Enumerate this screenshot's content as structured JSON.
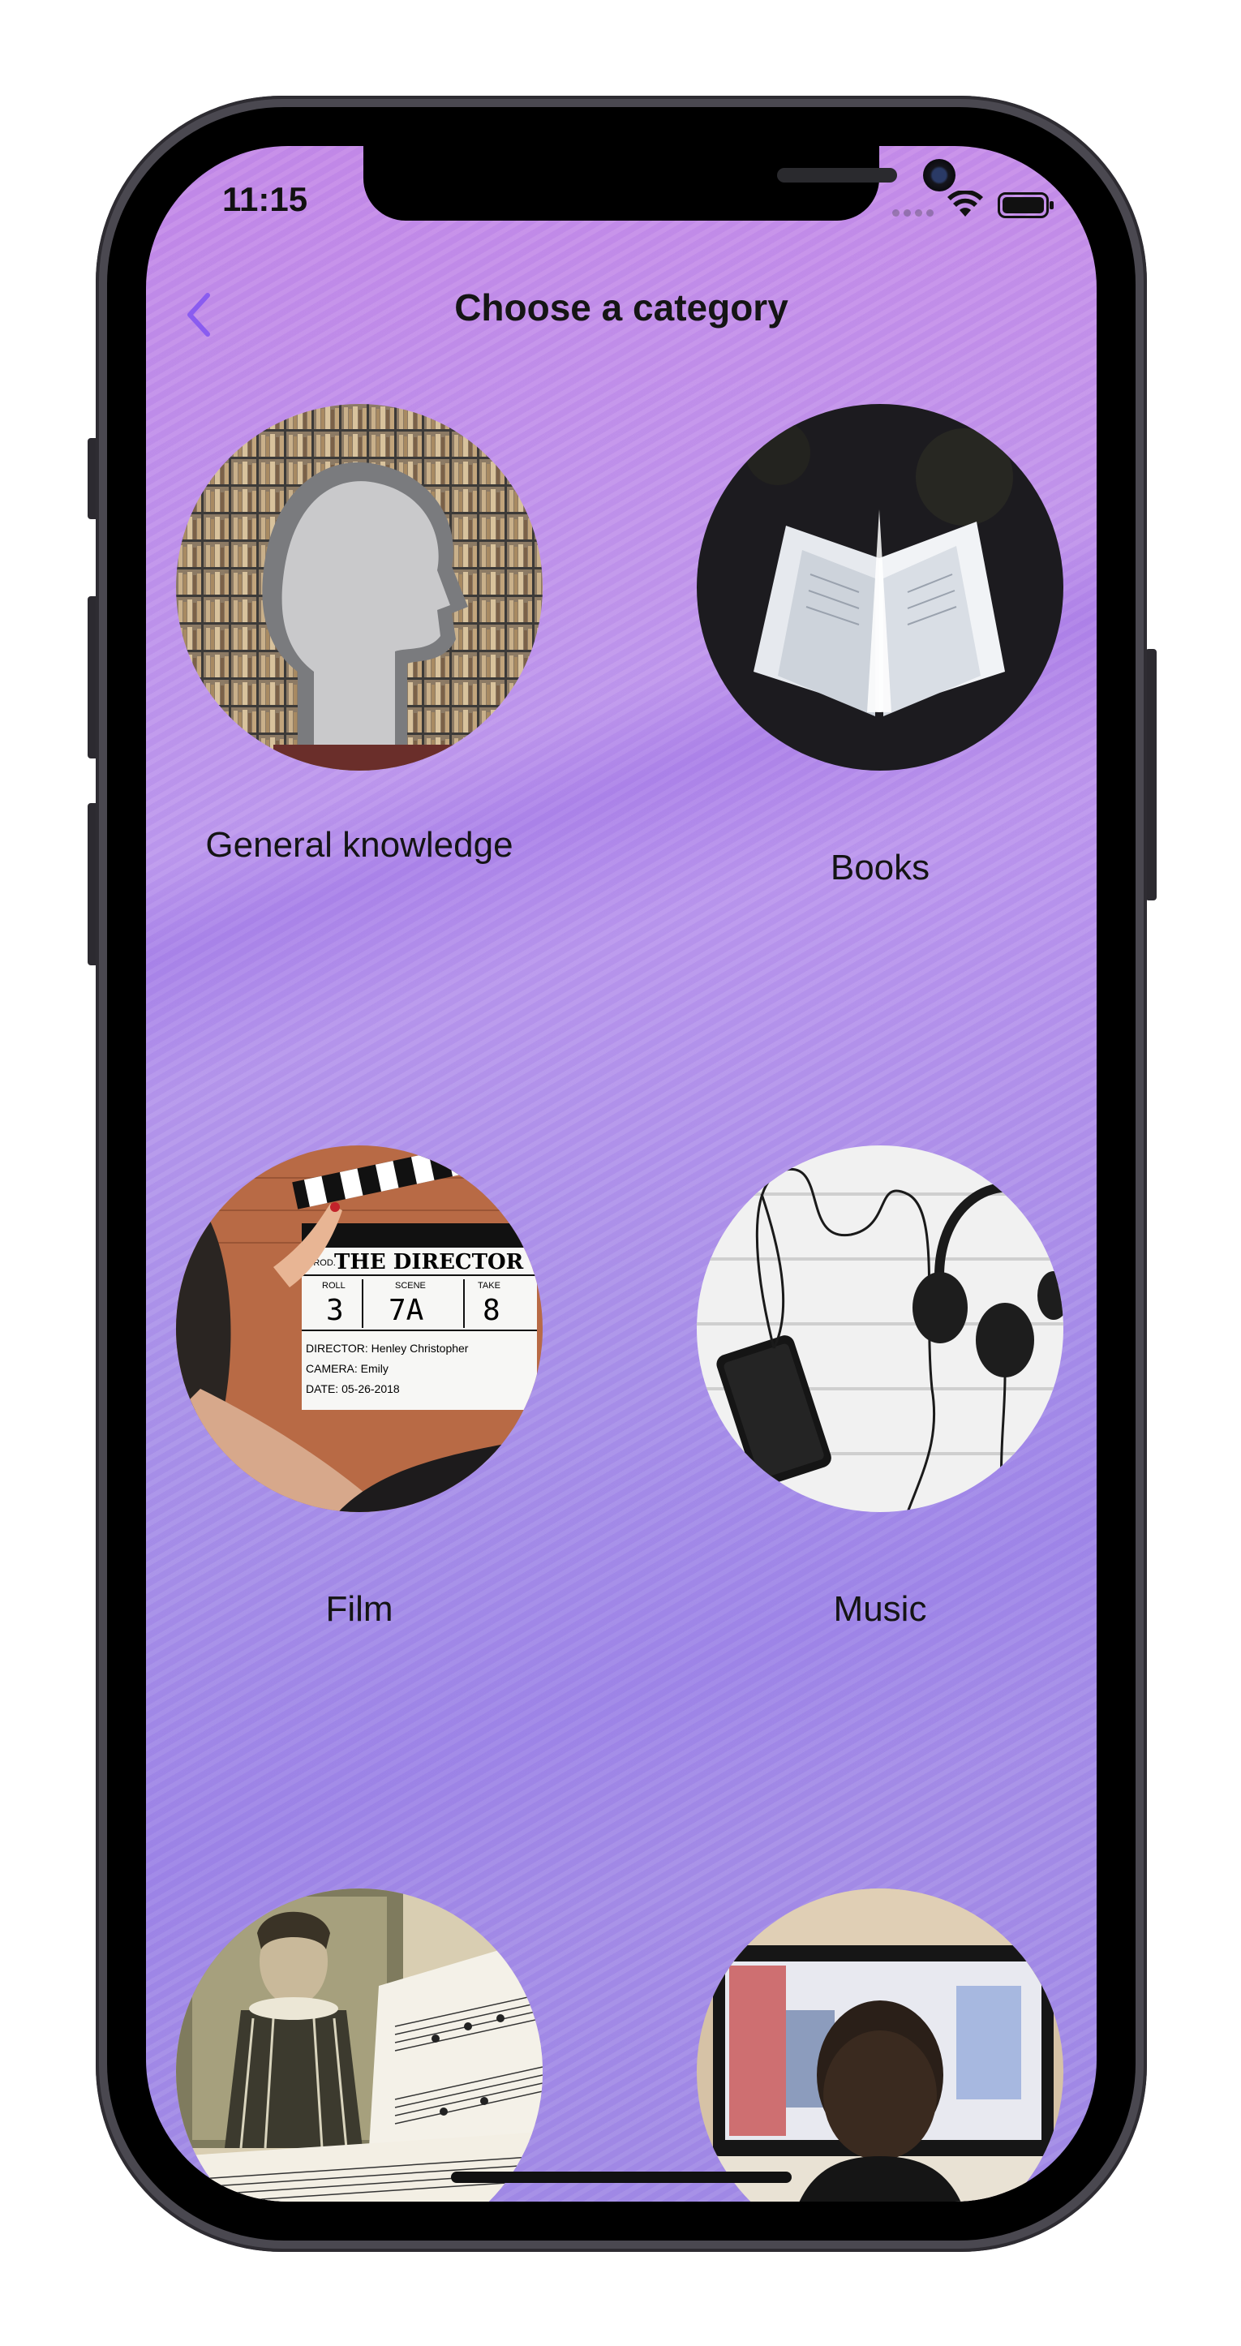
{
  "status_bar": {
    "time": "11:15"
  },
  "nav": {
    "title": "Choose a category",
    "back_icon": "chevron-left-icon"
  },
  "accent_color": "#8a5cf0",
  "categories": [
    {
      "label": "General knowledge",
      "image": "head-bookshelf-image"
    },
    {
      "label": "Books",
      "image": "open-book-image"
    },
    {
      "label": "Film",
      "image": "clapperboard-image"
    },
    {
      "label": "Music",
      "image": "headphones-phone-image"
    },
    {
      "label": "",
      "image": "shakespeare-sheet-music-image"
    },
    {
      "label": "",
      "image": "child-watching-tv-image"
    }
  ],
  "clapperboard": {
    "title": "THE DIRECTOR",
    "roll_label": "ROLL",
    "roll": "3",
    "scene_label": "SCENE",
    "scene": "7A",
    "take_label": "TAKE",
    "take": "8",
    "prod_label": "PROD.",
    "director_line": "DIRECTOR: Henley Christopher",
    "camera_line": "CAMERA: Emily",
    "date_line": "DATE: 05-26-2018"
  }
}
